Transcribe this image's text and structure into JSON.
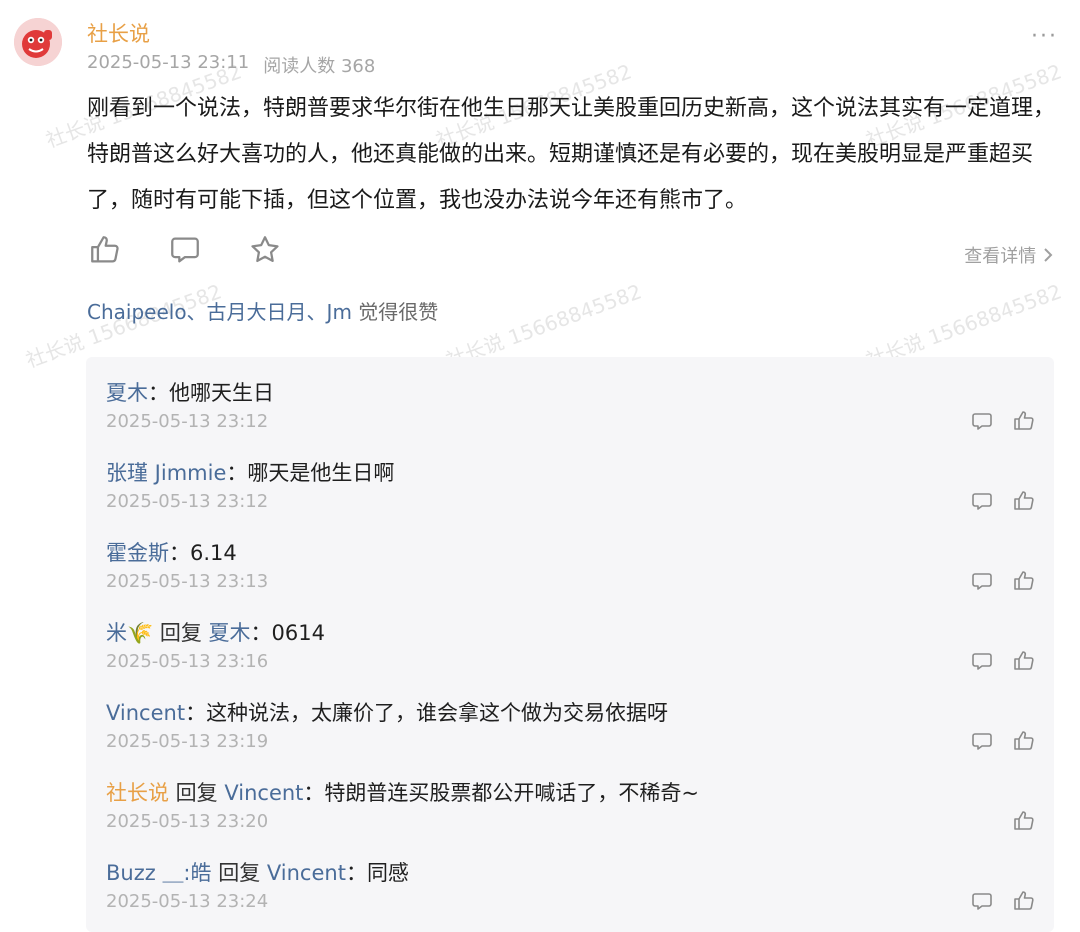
{
  "post": {
    "author": "社长说",
    "timestamp": "2025-05-13 23:11",
    "read_label": "阅读人数",
    "read_count": "368",
    "body": "刚看到一个说法，特朗普要求华尔街在他生日那天让美股重回历史新高，这个说法其实有一定道理，特朗普这么好大喜功的人，他还真能做的出来。短期谨慎还是有必要的，现在美股明显是严重超买了，随时有可能下插，但这个位置，我也没办法说今年还有熊市了。",
    "more_icon": "···",
    "detail_label": "查看详情",
    "likers": "Chaipeelo、古月大日月、Jm",
    "likers_suffix": " 觉得很赞"
  },
  "comments": [
    {
      "user": "夏木",
      "text": "他哪天生日",
      "time": "2025-05-13 23:12",
      "reply_to": "",
      "has_comment_icon": true
    },
    {
      "user": "张瑾 Jimmie",
      "text": "哪天是他生日啊",
      "time": "2025-05-13 23:12",
      "reply_to": "",
      "has_comment_icon": true
    },
    {
      "user": "霍金斯",
      "text": "6.14",
      "time": "2025-05-13 23:13",
      "reply_to": "",
      "has_comment_icon": true
    },
    {
      "user": "米🌾",
      "text": "0614",
      "time": "2025-05-13 23:16",
      "reply_to": "夏木",
      "has_comment_icon": true
    },
    {
      "user": "Vincent",
      "text": "这种说法，太廉价了，谁会拿这个做为交易依据呀",
      "time": "2025-05-13 23:19",
      "reply_to": "",
      "has_comment_icon": true
    },
    {
      "user": "社长说",
      "text": "特朗普连买股票都公开喊话了，不稀奇~",
      "time": "2025-05-13 23:20",
      "reply_to": "Vincent",
      "has_comment_icon": false,
      "is_author": true
    },
    {
      "user": "Buzz ＿:皓",
      "text": "同感",
      "time": "2025-05-13 23:24",
      "reply_to": "Vincent",
      "has_comment_icon": true
    }
  ],
  "labels": {
    "reply_word": "回复",
    "colon": "："
  },
  "watermark": "社长说 15668845582",
  "colors": {
    "author": "#e8a046",
    "username": "#4a6c99",
    "muted": "#a6a6a6",
    "panel": "#f6f6f8"
  }
}
